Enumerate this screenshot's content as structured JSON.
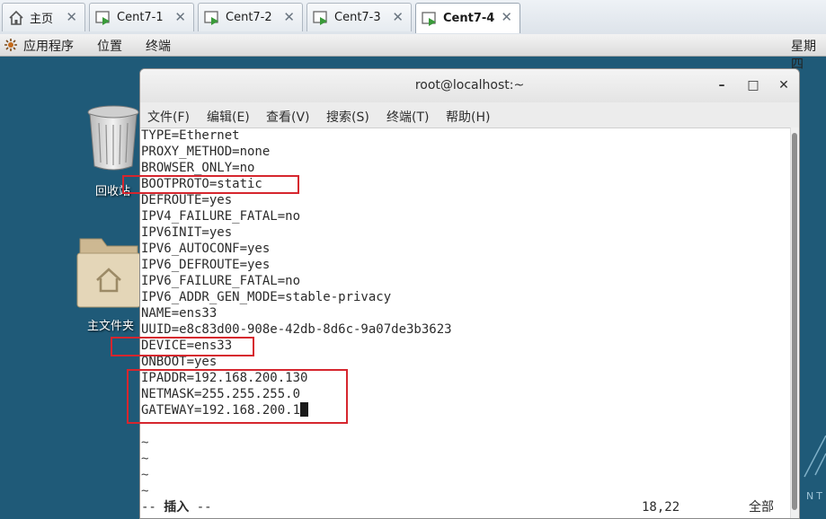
{
  "vm_tabs": [
    {
      "label": "主页",
      "icon": "home-icon"
    },
    {
      "label": "Cent7-1",
      "icon": "vm-icon"
    },
    {
      "label": "Cent7-2",
      "icon": "vm-icon"
    },
    {
      "label": "Cent7-3",
      "icon": "vm-icon"
    },
    {
      "label": "Cent7-4",
      "icon": "vm-icon",
      "active": true
    }
  ],
  "tab_close": "✕",
  "gnome_bar": {
    "applications": "应用程序",
    "places": "位置",
    "terminal": "终端",
    "clock": "星期四"
  },
  "desktop": {
    "trash_label": "回收站",
    "home_label": "主文件夹",
    "logo_text": "NT"
  },
  "window": {
    "title": "root@localhost:~",
    "minimize": "–",
    "maximize": "□",
    "close": "✕",
    "menu": [
      "文件(F)",
      "编辑(E)",
      "查看(V)",
      "搜索(S)",
      "终端(T)",
      "帮助(H)"
    ]
  },
  "editor": {
    "lines": [
      "TYPE=Ethernet",
      "PROXY_METHOD=none",
      "BROWSER_ONLY=no",
      "BOOTPROTO=static",
      "DEFROUTE=yes",
      "IPV4_FAILURE_FATAL=no",
      "IPV6INIT=yes",
      "IPV6_AUTOCONF=yes",
      "IPV6_DEFROUTE=yes",
      "IPV6_FAILURE_FATAL=no",
      "IPV6_ADDR_GEN_MODE=stable-privacy",
      "NAME=ens33",
      "UUID=e8c83d00-908e-42db-8d6c-9a07de3b3623",
      "DEVICE=ens33",
      "ONBOOT=yes",
      "IPADDR=192.168.200.130",
      "NETMASK=255.255.255.0",
      "GATEWAY=192.168.200.1"
    ],
    "tildes": [
      "~",
      "~",
      "~",
      "~"
    ],
    "status": {
      "mode_prefix": "-- ",
      "mode": "插入",
      "mode_suffix": " --",
      "position": "18,22",
      "scroll": "全部"
    }
  },
  "colors": {
    "highlight": "#d6262e",
    "desktop": "#1f5a78"
  }
}
